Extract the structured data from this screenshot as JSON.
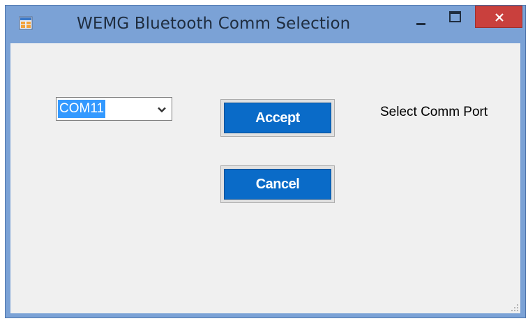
{
  "window": {
    "title": "WEMG Bluetooth Comm Selection",
    "icon": "application-icon",
    "controls": {
      "minimize": "minimize-icon",
      "maximize": "maximize-icon",
      "close": "close-icon"
    }
  },
  "form": {
    "comm_port": {
      "selected_value": "COM11"
    },
    "accept_label": "Accept",
    "cancel_label": "Cancel",
    "select_label": "Select Comm Port"
  },
  "colors": {
    "titlebar": "#7ba2d6",
    "close_button": "#c9403d",
    "button_face": "#0a6bc8",
    "selection": "#3399ff",
    "client_background": "#f0f0f0"
  }
}
